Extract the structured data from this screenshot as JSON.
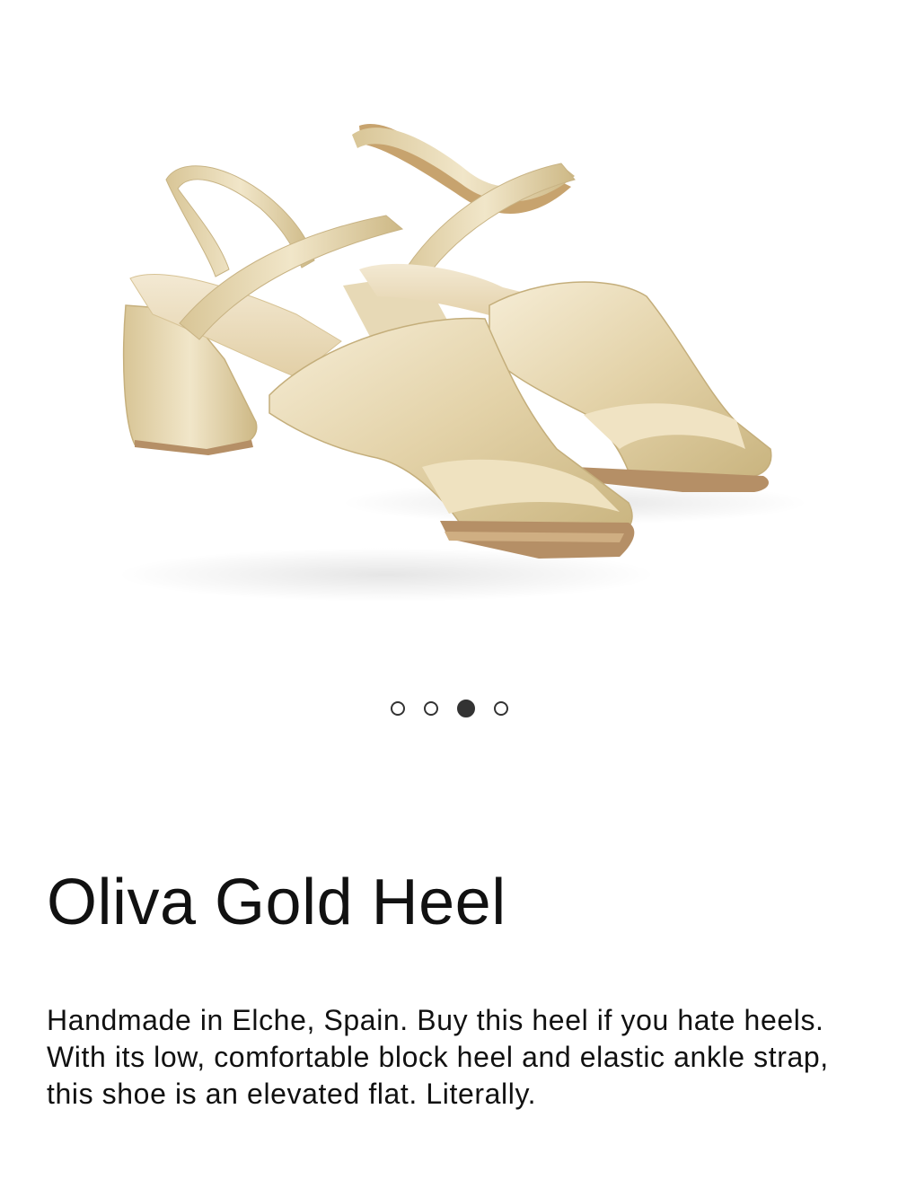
{
  "product": {
    "title": "Oliva Gold Heel",
    "description": "Handmade in Elche, Spain. Buy this heel if you hate heels. With its low, comfortable block heel and elastic ankle strap, this shoe is an elevated flat. Literally."
  },
  "gallery": {
    "image_count": 4,
    "active_index": 2,
    "image_subject": "gold metallic block-heel slingback sandals"
  },
  "colors": {
    "gold_light": "#efe3c4",
    "gold_mid": "#d9c69a",
    "gold_dark": "#b9a46f",
    "sole": "#b58f66",
    "dot": "#333333",
    "text": "#111111"
  }
}
